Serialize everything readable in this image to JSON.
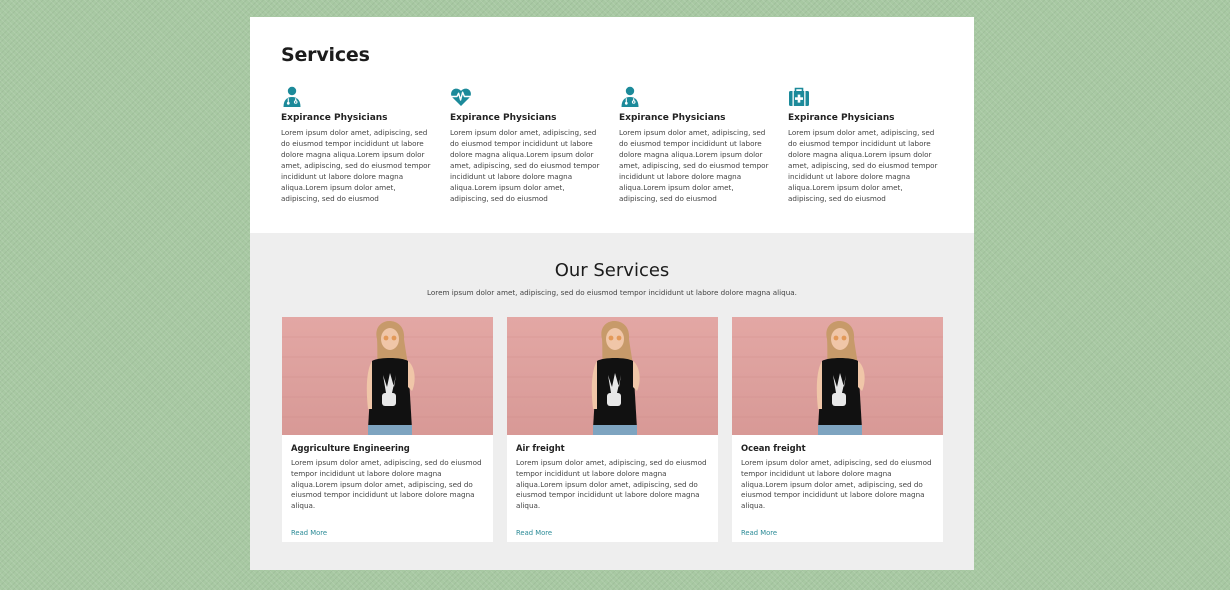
{
  "colors": {
    "outer_background": "#a8c9a3",
    "accent": "#1c8a9a",
    "link": "#2a8a96",
    "section_gray": "#eeeeee",
    "image_pink": "#e3a7a4"
  },
  "top_section": {
    "title": "Services",
    "features": [
      {
        "icon": "doctor-icon",
        "title": "Expirance Physicians",
        "text": "Lorem ipsum dolor amet, adipiscing, sed do eiusmod tempor incididunt ut labore dolore magna aliqua.Lorem ipsum dolor amet, adipiscing, sed do eiusmod tempor incididunt ut labore dolore magna aliqua.Lorem ipsum dolor amet, adipiscing, sed do eiusmod"
      },
      {
        "icon": "heartbeat-icon",
        "title": "Expirance Physicians",
        "text": "Lorem ipsum dolor amet, adipiscing, sed do eiusmod tempor incididunt ut labore dolore magna aliqua.Lorem ipsum dolor amet, adipiscing, sed do eiusmod tempor incididunt ut labore dolore magna aliqua.Lorem ipsum dolor amet, adipiscing, sed do eiusmod"
      },
      {
        "icon": "doctor-icon",
        "title": "Expirance Physicians",
        "text": "Lorem ipsum dolor amet, adipiscing, sed do eiusmod tempor incididunt ut labore dolore magna aliqua.Lorem ipsum dolor amet, adipiscing, sed do eiusmod tempor incididunt ut labore dolore magna aliqua.Lorem ipsum dolor amet, adipiscing, sed do eiusmod"
      },
      {
        "icon": "medical-kit-icon",
        "title": "Expirance Physicians",
        "text": "Lorem ipsum dolor amet, adipiscing, sed do eiusmod tempor incididunt ut labore dolore magna aliqua.Lorem ipsum dolor amet, adipiscing, sed do eiusmod tempor incididunt ut labore dolore magna aliqua.Lorem ipsum dolor amet, adipiscing, sed do eiusmod"
      }
    ]
  },
  "our_services": {
    "title": "Our Services",
    "subtitle": "Lorem ipsum dolor amet, adipiscing, sed do eiusmod tempor incididunt ut labore dolore magna aliqua.",
    "cards": [
      {
        "image": "woman-in-skeleton-hand-tshirt-photo",
        "title": "Aggriculture Engineering",
        "text": "Lorem ipsum dolor amet, adipiscing, sed do eiusmod tempor incididunt ut labore dolore magna aliqua.Lorem ipsum dolor amet, adipiscing, sed do eiusmod tempor incididunt ut labore dolore magna aliqua.",
        "link": "Read More"
      },
      {
        "image": "woman-in-skeleton-hand-tshirt-photo",
        "title": "Air freight",
        "text": "Lorem ipsum dolor amet, adipiscing, sed do eiusmod tempor incididunt ut labore dolore magna aliqua.Lorem ipsum dolor amet, adipiscing, sed do eiusmod tempor incididunt ut labore dolore magna aliqua.",
        "link": "Read More"
      },
      {
        "image": "woman-in-skeleton-hand-tshirt-photo",
        "title": "Ocean freight",
        "text": "Lorem ipsum dolor amet, adipiscing, sed do eiusmod tempor incididunt ut labore dolore magna aliqua.Lorem ipsum dolor amet, adipiscing, sed do eiusmod tempor incididunt ut labore dolore magna aliqua.",
        "link": "Read More"
      }
    ]
  }
}
